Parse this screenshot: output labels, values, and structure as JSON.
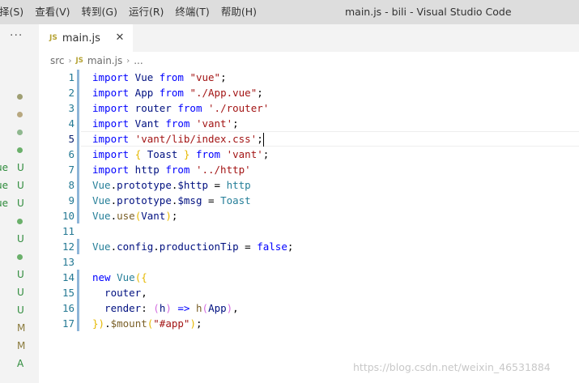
{
  "menu": [
    {
      "label": "择(S)"
    },
    {
      "label": "查看(V)"
    },
    {
      "label": "转到(G)"
    },
    {
      "label": "运行(R)"
    },
    {
      "label": "终端(T)"
    },
    {
      "label": "帮助(H)"
    }
  ],
  "window_title": "main.js - bili - Visual Studio Code",
  "sidebar": {
    "more": "···",
    "rows": [
      {
        "name": "",
        "status": "",
        "color": "#9f9f73",
        "kind": "dot"
      },
      {
        "name": "",
        "status": "",
        "color": "#b8a880",
        "kind": "dot"
      },
      {
        "name": "",
        "status": "",
        "color": "#8fb88f",
        "kind": "dot"
      },
      {
        "name": "",
        "status": "",
        "color": "#6bb06b",
        "kind": "dot"
      },
      {
        "name": "ue",
        "status": "U",
        "color": "#2e8b3b",
        "kind": "letter"
      },
      {
        "name": "ue",
        "status": "U",
        "color": "#2e8b3b",
        "kind": "letter"
      },
      {
        "name": "ue",
        "status": "U",
        "color": "#2e8b3b",
        "kind": "letter"
      },
      {
        "name": "",
        "status": "",
        "color": "#6bb06b",
        "kind": "dot"
      },
      {
        "name": "",
        "status": "U",
        "color": "#2e8b3b",
        "kind": "letter"
      },
      {
        "name": "",
        "status": "",
        "color": "#6bb06b",
        "kind": "dot"
      },
      {
        "name": "",
        "status": "U",
        "color": "#2e8b3b",
        "kind": "letter"
      },
      {
        "name": "",
        "status": "U",
        "color": "#2e8b3b",
        "kind": "letter"
      },
      {
        "name": "",
        "status": "U",
        "color": "#2e8b3b",
        "kind": "letter"
      },
      {
        "name": "",
        "status": "M",
        "color": "#8a7a3c",
        "kind": "letter"
      },
      {
        "name": "",
        "status": "M",
        "color": "#8a7a3c",
        "kind": "letter"
      },
      {
        "name": "",
        "status": "A",
        "color": "#2e8b3b",
        "kind": "letter"
      }
    ]
  },
  "tab": {
    "icon": "JS",
    "label": "main.js",
    "close": "✕"
  },
  "breadcrumb": {
    "folder": "src",
    "sep": "›",
    "icon": "JS",
    "file": "main.js",
    "more": "..."
  },
  "editor": {
    "line_numbers": [
      "1",
      "2",
      "3",
      "4",
      "5",
      "6",
      "7",
      "8",
      "9",
      "10",
      "11",
      "12",
      "13",
      "14",
      "15",
      "16",
      "17"
    ],
    "active_line": 5,
    "lines": [
      [
        {
          "t": "import",
          "c": "kw"
        },
        {
          "t": " Vue ",
          "c": "id"
        },
        {
          "t": "from",
          "c": "kw"
        },
        {
          "t": " ",
          "c": "punc"
        },
        {
          "t": "\"vue\"",
          "c": "str"
        },
        {
          "t": ";",
          "c": "punc"
        }
      ],
      [
        {
          "t": "import",
          "c": "kw"
        },
        {
          "t": " App ",
          "c": "id"
        },
        {
          "t": "from",
          "c": "kw"
        },
        {
          "t": " ",
          "c": "punc"
        },
        {
          "t": "\"./App.vue\"",
          "c": "str"
        },
        {
          "t": ";",
          "c": "punc"
        }
      ],
      [
        {
          "t": "import",
          "c": "kw"
        },
        {
          "t": " router ",
          "c": "id"
        },
        {
          "t": "from",
          "c": "kw"
        },
        {
          "t": " ",
          "c": "punc"
        },
        {
          "t": "'./router'",
          "c": "str"
        }
      ],
      [
        {
          "t": "import",
          "c": "kw"
        },
        {
          "t": " Vant ",
          "c": "id"
        },
        {
          "t": "from",
          "c": "kw"
        },
        {
          "t": " ",
          "c": "punc"
        },
        {
          "t": "'vant'",
          "c": "str"
        },
        {
          "t": ";",
          "c": "punc"
        }
      ],
      [
        {
          "t": "import",
          "c": "kw"
        },
        {
          "t": " ",
          "c": "punc"
        },
        {
          "t": "'vant/lib/index.css'",
          "c": "str"
        },
        {
          "t": ";",
          "c": "punc"
        }
      ],
      [
        {
          "t": "import",
          "c": "kw"
        },
        {
          "t": " ",
          "c": "punc"
        },
        {
          "t": "{",
          "c": "br1"
        },
        {
          "t": " Toast ",
          "c": "id"
        },
        {
          "t": "}",
          "c": "br1"
        },
        {
          "t": " ",
          "c": "punc"
        },
        {
          "t": "from",
          "c": "kw"
        },
        {
          "t": " ",
          "c": "punc"
        },
        {
          "t": "'vant'",
          "c": "str"
        },
        {
          "t": ";",
          "c": "punc"
        }
      ],
      [
        {
          "t": "import",
          "c": "kw"
        },
        {
          "t": " http ",
          "c": "id"
        },
        {
          "t": "from",
          "c": "kw"
        },
        {
          "t": " ",
          "c": "punc"
        },
        {
          "t": "'../http'",
          "c": "str"
        }
      ],
      [
        {
          "t": "Vue",
          "c": "type"
        },
        {
          "t": ".",
          "c": "punc"
        },
        {
          "t": "prototype",
          "c": "id"
        },
        {
          "t": ".",
          "c": "punc"
        },
        {
          "t": "$http",
          "c": "id"
        },
        {
          "t": " = ",
          "c": "punc"
        },
        {
          "t": "http",
          "c": "type"
        }
      ],
      [
        {
          "t": "Vue",
          "c": "type"
        },
        {
          "t": ".",
          "c": "punc"
        },
        {
          "t": "prototype",
          "c": "id"
        },
        {
          "t": ".",
          "c": "punc"
        },
        {
          "t": "$msg",
          "c": "id"
        },
        {
          "t": " = ",
          "c": "punc"
        },
        {
          "t": "Toast",
          "c": "type"
        }
      ],
      [
        {
          "t": "Vue",
          "c": "type"
        },
        {
          "t": ".",
          "c": "punc"
        },
        {
          "t": "use",
          "c": "fn"
        },
        {
          "t": "(",
          "c": "br1"
        },
        {
          "t": "Vant",
          "c": "id"
        },
        {
          "t": ")",
          "c": "br1"
        },
        {
          "t": ";",
          "c": "punc"
        }
      ],
      [],
      [
        {
          "t": "Vue",
          "c": "type"
        },
        {
          "t": ".",
          "c": "punc"
        },
        {
          "t": "config",
          "c": "id"
        },
        {
          "t": ".",
          "c": "punc"
        },
        {
          "t": "productionTip",
          "c": "id"
        },
        {
          "t": " = ",
          "c": "punc"
        },
        {
          "t": "false",
          "c": "kw"
        },
        {
          "t": ";",
          "c": "punc"
        }
      ],
      [],
      [
        {
          "t": "new",
          "c": "kw"
        },
        {
          "t": " ",
          "c": "punc"
        },
        {
          "t": "Vue",
          "c": "type"
        },
        {
          "t": "({",
          "c": "br1"
        }
      ],
      [
        {
          "t": "  router",
          "c": "id"
        },
        {
          "t": ",",
          "c": "punc"
        }
      ],
      [
        {
          "t": "  render",
          "c": "id"
        },
        {
          "t": ": ",
          "c": "punc"
        },
        {
          "t": "(",
          "c": "br2"
        },
        {
          "t": "h",
          "c": "id"
        },
        {
          "t": ")",
          "c": "br2"
        },
        {
          "t": " ",
          "c": "punc"
        },
        {
          "t": "=>",
          "c": "kw"
        },
        {
          "t": " ",
          "c": "punc"
        },
        {
          "t": "h",
          "c": "fn"
        },
        {
          "t": "(",
          "c": "br2"
        },
        {
          "t": "App",
          "c": "id"
        },
        {
          "t": ")",
          "c": "br2"
        },
        {
          "t": ",",
          "c": "punc"
        }
      ],
      [
        {
          "t": "})",
          "c": "br1"
        },
        {
          "t": ".",
          "c": "punc"
        },
        {
          "t": "$mount",
          "c": "fn"
        },
        {
          "t": "(",
          "c": "br1"
        },
        {
          "t": "\"#app\"",
          "c": "str"
        },
        {
          "t": ")",
          "c": "br1"
        },
        {
          "t": ";",
          "c": "punc"
        }
      ]
    ]
  },
  "watermark": "https://blog.csdn.net/weixin_46531884",
  "colors": {
    "keyword": "#0000ff",
    "string": "#a31515",
    "identifier": "#001080",
    "line_number": "#237893",
    "git_modified_bar": "#8eb5d8"
  }
}
